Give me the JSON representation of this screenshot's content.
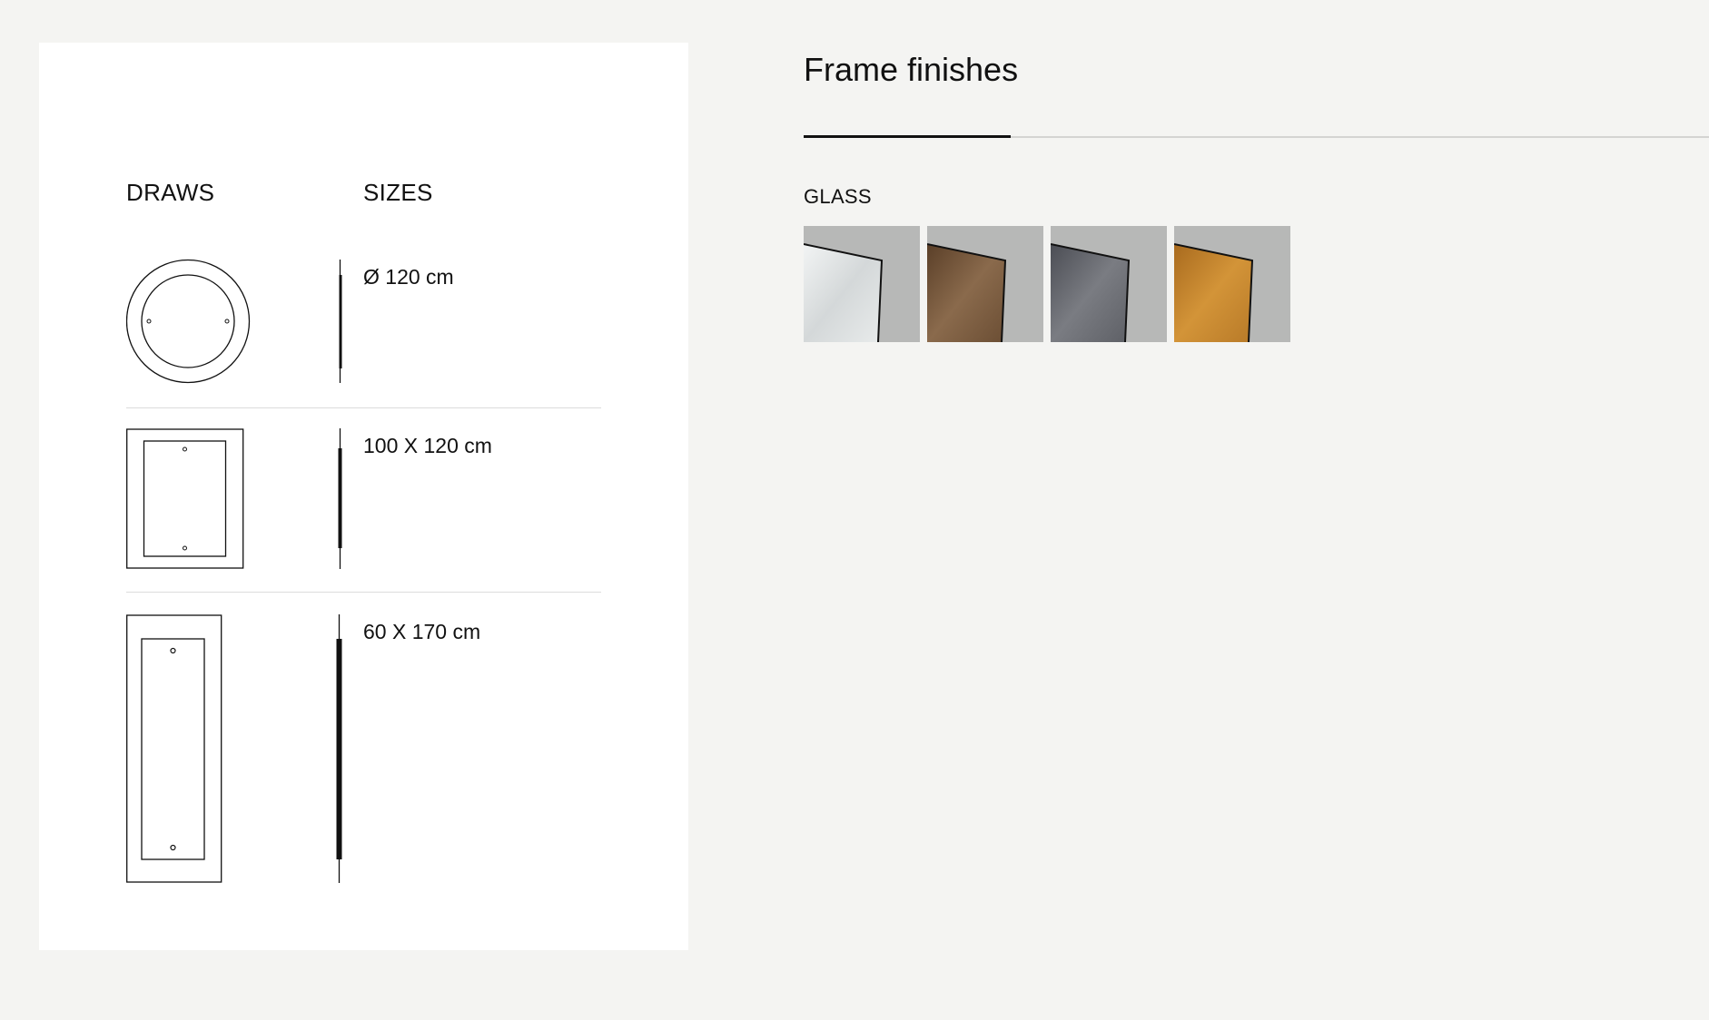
{
  "drawings_panel": {
    "draws_header": "DRAWS",
    "sizes_header": "SIZES",
    "rows": [
      {
        "shape": "round-mirror-icon",
        "size": "Ø 120 cm"
      },
      {
        "shape": "rectangular-mirror-icon",
        "size": "100 X 120 cm"
      },
      {
        "shape": "tall-mirror-icon",
        "size": "60 X 170 cm"
      }
    ]
  },
  "finishes": {
    "title": "Frame finishes",
    "group_label": "GLASS",
    "swatches": [
      {
        "name": "clear-glass",
        "color": "#dfe3e4"
      },
      {
        "name": "bronze-glass",
        "color": "#7a5a3c"
      },
      {
        "name": "grey-glass",
        "color": "#6a6c72"
      },
      {
        "name": "gold-glass",
        "color": "#c2822e"
      }
    ]
  }
}
